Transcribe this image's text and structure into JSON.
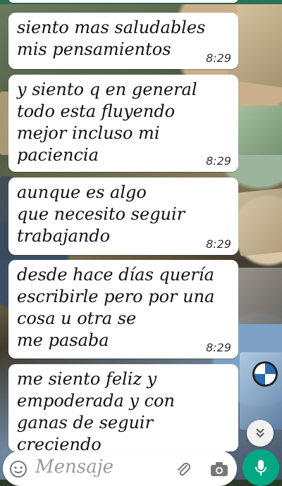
{
  "colors": {
    "bubble_bg": "#ffffff",
    "accent_green": "#00a884",
    "time_text": "#333333",
    "placeholder_text": "#9a9a9a"
  },
  "messages": [
    {
      "text": "siento mas saludables\nmis pensamientos",
      "time": "8:29"
    },
    {
      "text": "y siento q en general\ntodo esta fluyendo\nmejor incluso mi\npaciencia",
      "time": "8:29"
    },
    {
      "text": "aunque es algo\nque necesito seguir\ntrabajando",
      "time": "8:29"
    },
    {
      "text": "desde hace días quería\nescribirle pero por una\ncosa u otra se\nme pasaba",
      "time": "8:29"
    },
    {
      "text": "me siento feliz y\nempoderada y con\nganas de seguir\ncreciendo",
      "time": ""
    }
  ],
  "composer": {
    "placeholder": "Mensaje",
    "icons": [
      "emoji-icon",
      "paperclip-icon",
      "camera-icon",
      "mic-icon"
    ]
  },
  "scroll_button_icon": "double-chevron-down-icon"
}
